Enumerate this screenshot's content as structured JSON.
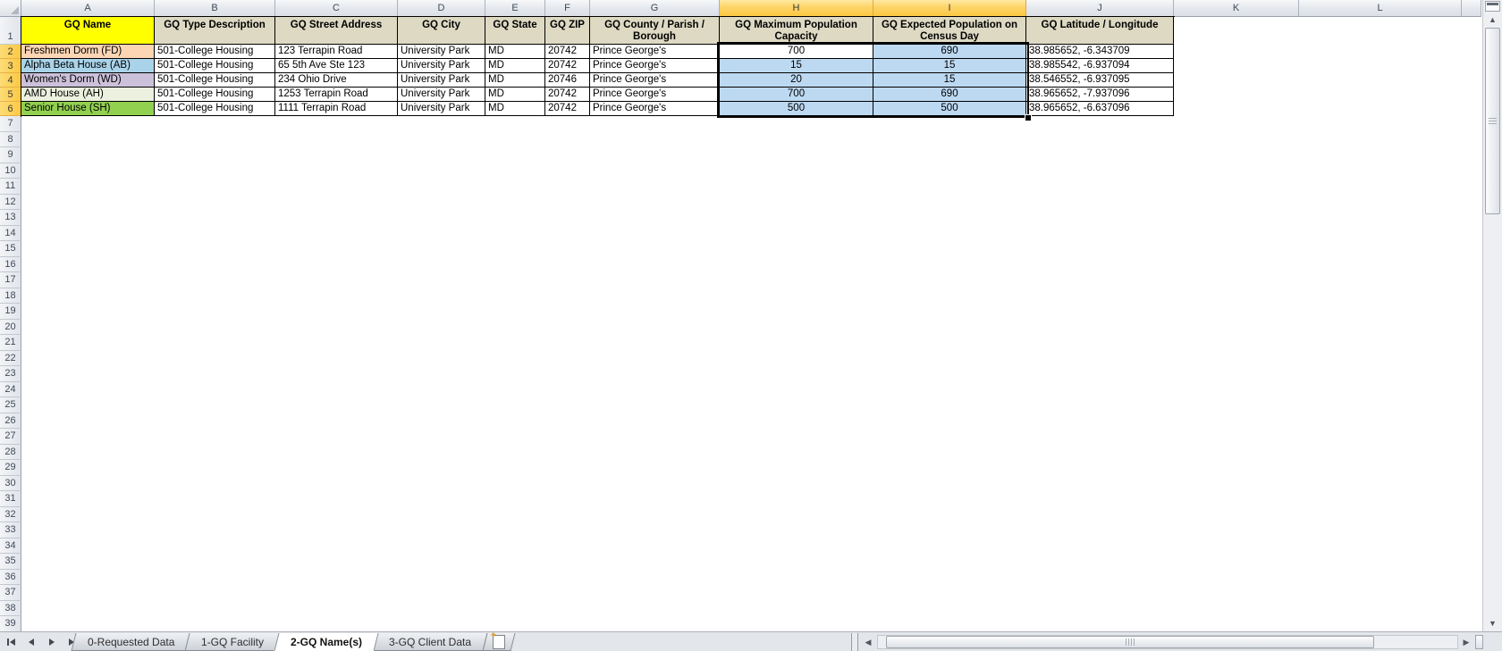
{
  "app": "spreadsheet-grid",
  "columns": {
    "letters": [
      "A",
      "B",
      "C",
      "D",
      "E",
      "F",
      "G",
      "H",
      "I",
      "J",
      "K",
      "L"
    ],
    "selected": [
      "H",
      "I"
    ]
  },
  "rows": {
    "count": 39,
    "selected": [
      2,
      3,
      4,
      5,
      6
    ]
  },
  "table": {
    "headers": [
      {
        "label": "GQ Name",
        "bg": "#FFFF00"
      },
      {
        "label": "GQ Type Description",
        "bg": "#DDD9C3"
      },
      {
        "label": "GQ Street Address",
        "bg": "#DDD9C3"
      },
      {
        "label": "GQ City",
        "bg": "#DDD9C3"
      },
      {
        "label": "GQ State",
        "bg": "#DDD9C3"
      },
      {
        "label": "GQ ZIP",
        "bg": "#DDD9C3"
      },
      {
        "label": "GQ County / Parish / Borough",
        "bg": "#DDD9C3"
      },
      {
        "label": "GQ Maximum Population Capacity",
        "bg": "#DDD9C3"
      },
      {
        "label": "GQ Expected Population on Census Day",
        "bg": "#DDD9C3"
      },
      {
        "label": "GQ Latitude / Longitude",
        "bg": "#DDD9C3"
      }
    ],
    "rows": [
      {
        "name": "Freshmen Dorm (FD)",
        "name_bg": "#FCD5B4",
        "type": "501-College Housing",
        "street": "123 Terrapin Road",
        "city": "University Park",
        "state": "MD",
        "zip": "20742",
        "county": "Prince George's",
        "max_capacity": "700",
        "expected_population": "690",
        "lat_long": "38.985652, -6.343709"
      },
      {
        "name": "Alpha Beta House (AB)",
        "name_bg": "#A9D3E9",
        "type": "501-College Housing",
        "street": "65 5th Ave Ste 123",
        "city": "University Park",
        "state": "MD",
        "zip": "20742",
        "county": "Prince George's",
        "max_capacity": "15",
        "expected_population": "15",
        "lat_long": "38.985542, -6.937094"
      },
      {
        "name": "Women's Dorm (WD)",
        "name_bg": "#CCC1DA",
        "type": "501-College Housing",
        "street": "234 Ohio Drive",
        "city": "University Park",
        "state": "MD",
        "zip": "20746",
        "county": "Prince George's",
        "max_capacity": "20",
        "expected_population": "15",
        "lat_long": "38.546552, -6.937095"
      },
      {
        "name": "AMD House (AH)",
        "name_bg": "#EBF1DE",
        "type": "501-College Housing",
        "street": "1253 Terrapin Road",
        "city": "University Park",
        "state": "MD",
        "zip": "20742",
        "county": "Prince George's",
        "max_capacity": "700",
        "expected_population": "690",
        "lat_long": "38.965652, -7.937096"
      },
      {
        "name": "Senior House (SH)",
        "name_bg": "#92D050",
        "type": "501-College Housing",
        "street": "1111 Terrapin Road",
        "city": "University Park",
        "state": "MD",
        "zip": "20742",
        "county": "Prince George's",
        "max_capacity": "500",
        "expected_population": "500",
        "lat_long": "38.965652, -6.637096"
      }
    ]
  },
  "selection": {
    "range": "H2:I6",
    "active_cell": "H2",
    "highlight_fill": "#BDD9F2"
  },
  "sheet_tabs": {
    "tabs": [
      {
        "label": "0-Requested Data",
        "active": false
      },
      {
        "label": "1-GQ Facility",
        "active": false
      },
      {
        "label": "2-GQ Name(s)",
        "active": true
      },
      {
        "label": "3-GQ Client Data",
        "active": false
      }
    ]
  },
  "icons": {
    "first_sheet": "|◀",
    "previous_sheet": "◀",
    "next_sheet": "▶",
    "last_sheet": "▶|",
    "insert_worksheet": "sheet-with-spark",
    "scroll_up": "▲",
    "scroll_down": "▼",
    "scroll_left": "◀",
    "scroll_right": "▶",
    "select_all": "corner-triangle",
    "insert_spark": "✦"
  },
  "colors": {
    "header_fill": "#DDD9C3",
    "gq_name_header_fill": "#FFFF00",
    "selected_header_amber": "#FBC843",
    "selection_blue": "#BDD9F2",
    "grid_border": "#000000"
  }
}
